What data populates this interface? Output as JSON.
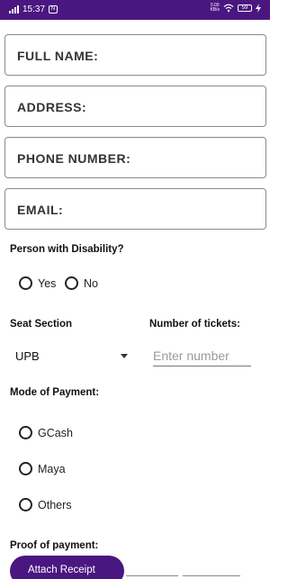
{
  "status_bar": {
    "time": "15:37",
    "notification_icon": "N",
    "net_speed_top": "0.00",
    "net_speed_bottom": "KB/s",
    "battery": "59",
    "color": "#4a1780"
  },
  "form": {
    "full_name_label": "FULL NAME:",
    "address_label": "ADDRESS:",
    "phone_label": "PHONE NUMBER:",
    "email_label": "EMAIL:",
    "disability": {
      "label": "Person with Disability?",
      "options": [
        "Yes",
        "No"
      ]
    },
    "seat_section": {
      "label": "Seat Section",
      "selected": "UPB"
    },
    "tickets": {
      "label": "Number of tickets:",
      "placeholder": "Enter number"
    },
    "payment": {
      "label": "Mode of Payment:",
      "options": [
        "GCash",
        "Maya",
        "Others"
      ]
    },
    "proof": {
      "label": "Proof of payment:",
      "button_label": "Attach Receipt"
    }
  },
  "icons": [
    "signal-icon",
    "notification-icon",
    "wifi-icon",
    "battery-icon",
    "charging-icon",
    "dropdown-arrow-icon"
  ]
}
